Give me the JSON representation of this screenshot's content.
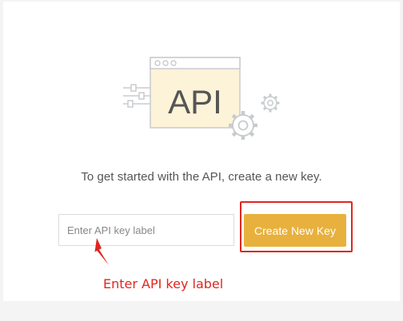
{
  "illustration": {
    "label": "API",
    "icons": [
      "browser-window-icon",
      "slider-lines-icon",
      "gear-icon",
      "small-gear-icon"
    ],
    "colors": {
      "line": "#c8cbcd",
      "window_fill": "#fdf3d8",
      "label": "#555555"
    }
  },
  "intro": {
    "text": "To get started with the API, create a new key."
  },
  "key_form": {
    "input_placeholder": "Enter API key label",
    "input_value": "",
    "create_button_label": "Create New Key",
    "colors": {
      "button": "#e8b13d",
      "button_text": "#ffffff"
    }
  },
  "annotation": {
    "text": "Enter API key label",
    "color": "#e0261f"
  }
}
